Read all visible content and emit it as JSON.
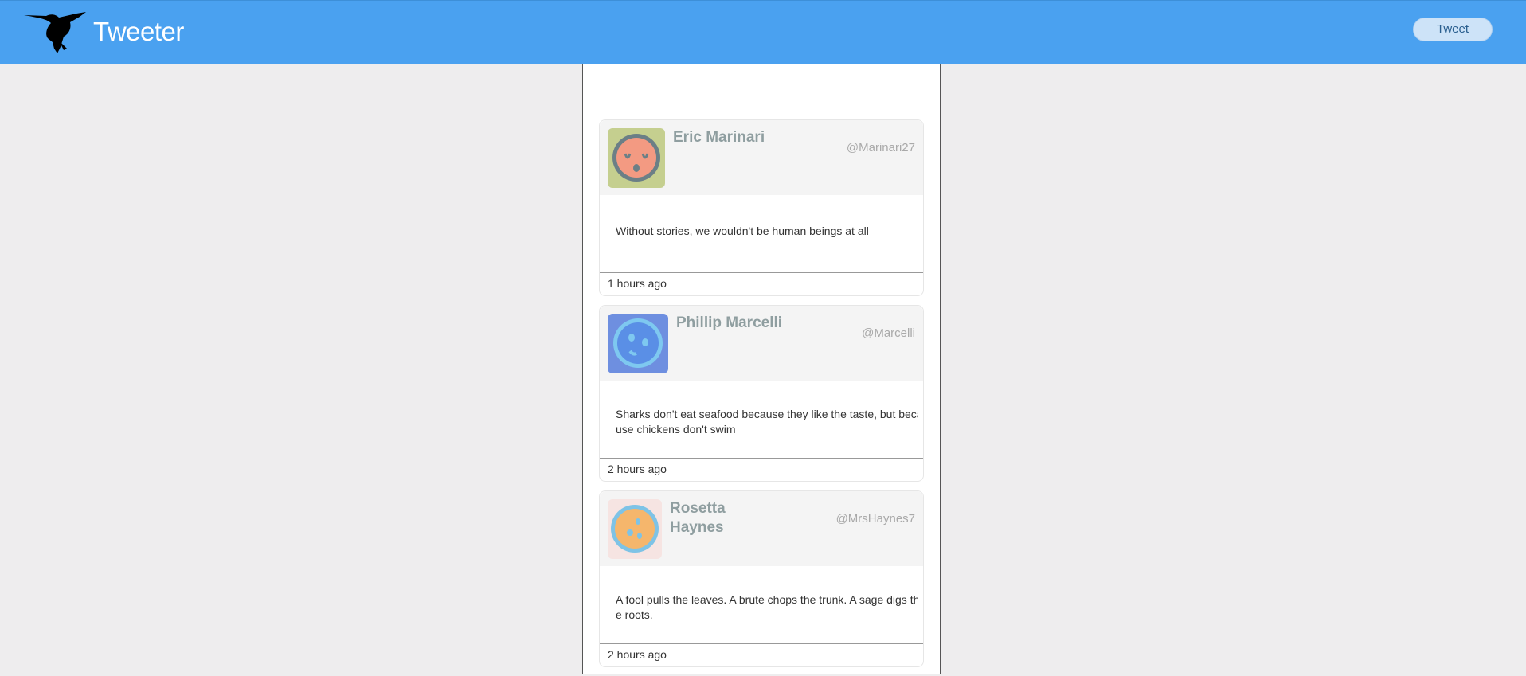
{
  "navbar": {
    "brand": "Tweeter",
    "logo_icon": "hummingbird-icon",
    "tweet_button_label": "Tweet",
    "colors": {
      "bar": "#4aa1f0",
      "button": "#cde3f8"
    }
  },
  "tweets": [
    {
      "name": "Eric Marinari",
      "handle": "@Marinari27",
      "text_lines": [
        "Without stories, we wouldn't be human beings at all"
      ],
      "time": "1 hours ago",
      "avatar_icon": "sleepy-face-avatar-icon",
      "avatar_colors": {
        "bg": "#c5cf8f",
        "face": "#f39a82",
        "ring": "#6b7f86"
      }
    },
    {
      "name": "Phillip Marcelli",
      "handle": "@Marcelli",
      "text_lines": [
        "Sharks don't eat seafood because they like the taste, but beca",
        "use chickens don't swim"
      ],
      "time": "2 hours ago",
      "avatar_icon": "blue-face-avatar-icon",
      "avatar_colors": {
        "bg": "#6e8fe0",
        "face": "#5a8fe6",
        "ring": "#7ec8f0"
      }
    },
    {
      "name_lines": [
        "Rosetta",
        "Haynes"
      ],
      "handle": "@MrsHaynes7",
      "text_lines": [
        "A fool pulls the leaves. A brute chops the trunk. A sage digs th",
        "e roots."
      ],
      "time": "2 hours ago",
      "avatar_icon": "orange-face-avatar-icon",
      "avatar_colors": {
        "bg": "#f6e4e2",
        "face": "#f5b66c",
        "ring": "#7ec3e6"
      }
    }
  ]
}
